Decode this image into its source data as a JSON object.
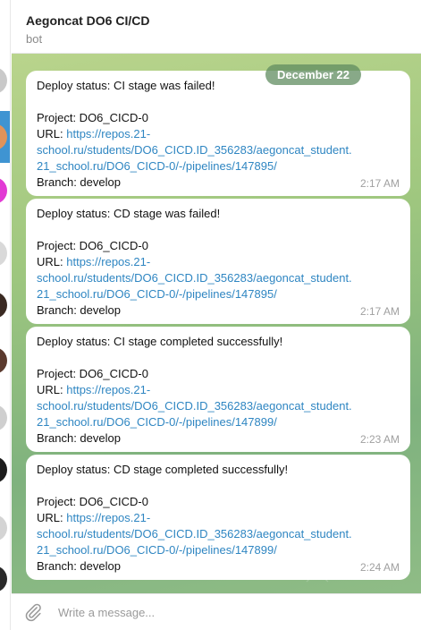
{
  "chat": {
    "title": "Aegoncat DO6 CI/CD",
    "subtitle": "bot",
    "date": "December 22"
  },
  "messages": [
    {
      "status": "Deploy status: CI stage was failed!",
      "project": "Project: DO6_CICD-0",
      "url_label": "URL: ",
      "url_line1": "https://repos.21-",
      "url_line2": "school.ru/students/DO6_CICD.ID_356283/aegoncat_student.",
      "url_line3": "21_school.ru/DO6_CICD-0/-/pipelines/147895/",
      "branch": "Branch: develop",
      "time": "2:17 AM"
    },
    {
      "status": "Deploy status: CD stage was failed!",
      "project": "Project: DO6_CICD-0",
      "url_label": "URL: ",
      "url_line1": "https://repos.21-",
      "url_line2": "school.ru/students/DO6_CICD.ID_356283/aegoncat_student.",
      "url_line3": "21_school.ru/DO6_CICD-0/-/pipelines/147895/",
      "branch": "Branch: develop",
      "time": "2:17 AM"
    },
    {
      "status": "Deploy status: CI stage completed successfully!",
      "project": "Project: DO6_CICD-0",
      "url_label": "URL: ",
      "url_line1": "https://repos.21-",
      "url_line2": "school.ru/students/DO6_CICD.ID_356283/aegoncat_student.",
      "url_line3": "21_school.ru/DO6_CICD-0/-/pipelines/147899/",
      "branch": "Branch: develop",
      "time": "2:23 AM"
    },
    {
      "status": "Deploy status: CD stage completed successfully!",
      "project": "Project: DO6_CICD-0",
      "url_label": "URL: ",
      "url_line1": "https://repos.21-",
      "url_line2": "school.ru/students/DO6_CICD.ID_356283/aegoncat_student.",
      "url_line3": "21_school.ru/DO6_CICD-0/-/pipelines/147899/",
      "branch": "Branch: develop",
      "time": "2:24 AM"
    }
  ],
  "composer": {
    "placeholder": "Write a message..."
  },
  "colors": {
    "link": "#2f86c2",
    "selected_chat": "#3f94d2",
    "date_pill": "#608c60"
  },
  "icons": {
    "attach": "paperclip-icon"
  }
}
